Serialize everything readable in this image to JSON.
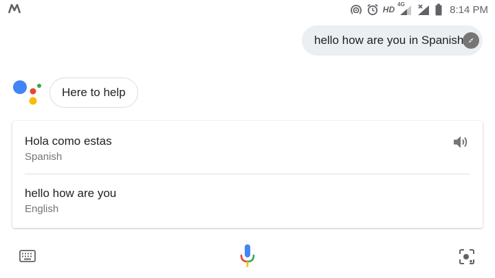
{
  "status_bar": {
    "hd": "HD",
    "network": "4G",
    "time": "8:14 PM",
    "icons": [
      "motorola-logo-icon",
      "hotspot-icon",
      "alarm-icon",
      "signal-icon",
      "no-sim-signal-icon",
      "battery-icon"
    ]
  },
  "conversation": {
    "user_query": "hello how are you in Spanish",
    "assistant_reply": "Here to help"
  },
  "translation": {
    "translated_text": "Hola como estas",
    "target_language": "Spanish",
    "source_text": "hello how are you",
    "source_language": "English"
  },
  "bottom_bar": {
    "icons": [
      "keyboard-icon",
      "microphone-icon",
      "lens-icon"
    ]
  },
  "colors": {
    "google_blue": "#4285F4",
    "google_red": "#EA4335",
    "google_yellow": "#FBBC05",
    "google_green": "#34A853",
    "bubble_gray": "#eceff1",
    "icon_gray": "#5f6368"
  }
}
